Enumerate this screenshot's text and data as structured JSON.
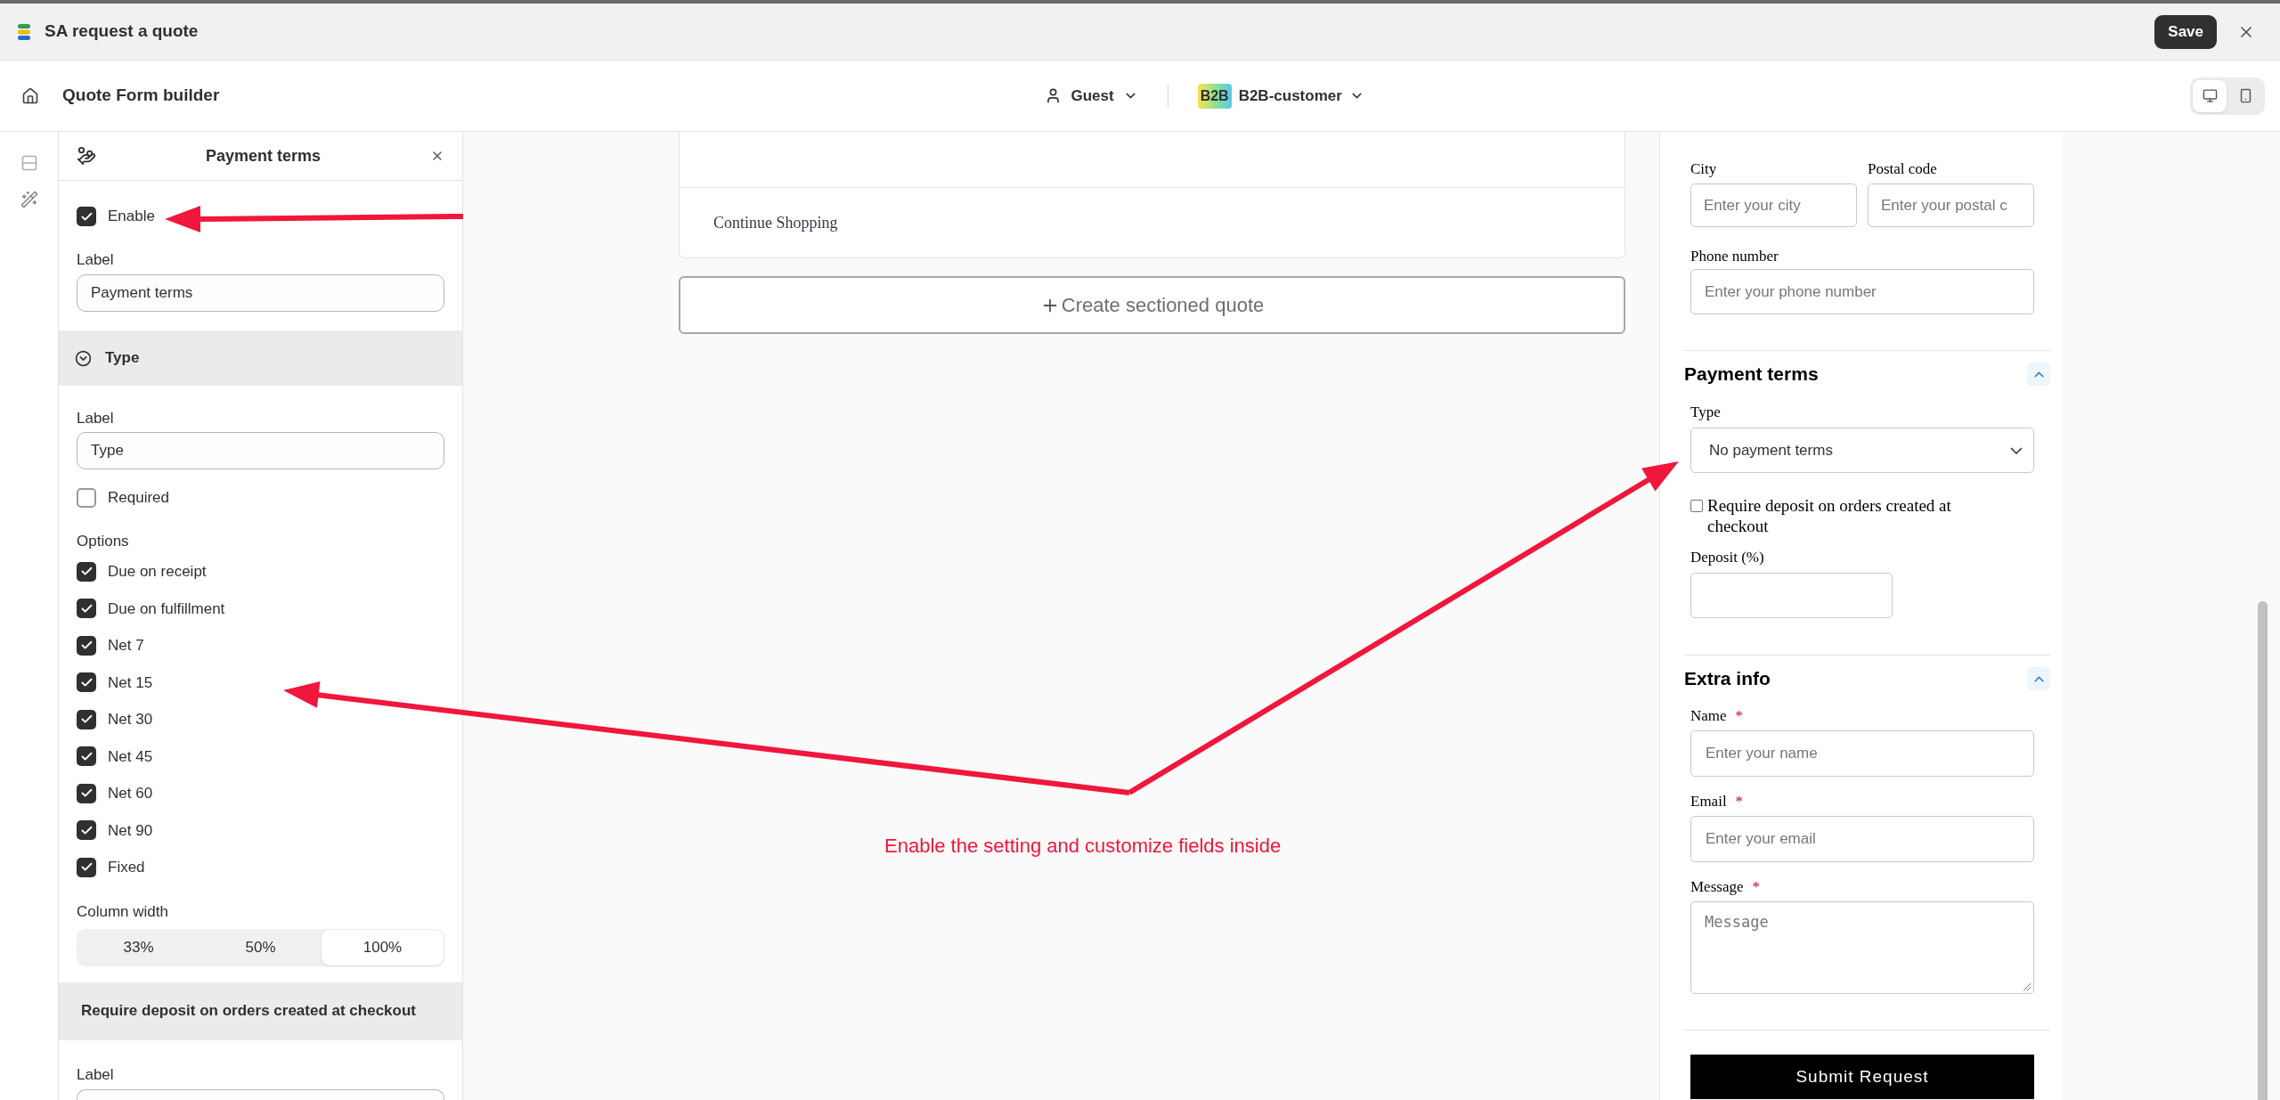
{
  "window": {
    "title": "SA request a quote",
    "save_button": "Save"
  },
  "toolbar": {
    "title": "Quote Form builder",
    "customer": "Guest",
    "customer_group_badge": "B2B",
    "customer_group": "B2B-customer",
    "views": [
      {
        "kind": "desktop",
        "selected": true
      },
      {
        "kind": "mobile",
        "selected": false
      }
    ]
  },
  "settings_panel": {
    "title": "Payment terms",
    "enable": {
      "label": "Enable",
      "checked": true
    },
    "label_field": {
      "label": "Label",
      "value": "Payment terms"
    },
    "type_section": {
      "title": "Type",
      "label_field": {
        "label": "Label",
        "value": "Type"
      },
      "required": {
        "label": "Required",
        "checked": false
      },
      "options_label": "Options",
      "options": [
        {
          "label": "Due on receipt",
          "checked": true
        },
        {
          "label": "Due on fulfillment",
          "checked": true
        },
        {
          "label": "Net 7",
          "checked": true
        },
        {
          "label": "Net 15",
          "checked": true
        },
        {
          "label": "Net 30",
          "checked": true
        },
        {
          "label": "Net 45",
          "checked": true
        },
        {
          "label": "Net 60",
          "checked": true
        },
        {
          "label": "Net 90",
          "checked": true
        },
        {
          "label": "Fixed",
          "checked": true
        }
      ],
      "column_width_label": "Column width",
      "column_widths": [
        {
          "label": "33%",
          "selected": false
        },
        {
          "label": "50%",
          "selected": false
        },
        {
          "label": "100%",
          "selected": true
        }
      ]
    },
    "deposit_section": {
      "title": "Require deposit on orders created at checkout",
      "label_field_label": "Label"
    }
  },
  "preview": {
    "continue_link": "Continue Shopping",
    "create_button": "Create sectioned quote"
  },
  "form": {
    "address_fields": [
      {
        "label": "City",
        "placeholder": "Enter your city"
      },
      {
        "label": "Postal code",
        "placeholder": "Enter your postal c"
      }
    ],
    "phone_field": {
      "label": "Phone number",
      "placeholder": "Enter your phone number"
    },
    "sections": [
      {
        "title": "Payment terms",
        "expanded": true,
        "fields": [
          {
            "kind": "select",
            "label": "Type",
            "value": "No payment terms"
          },
          {
            "kind": "checkbox",
            "label": "Require deposit on orders created at checkout",
            "checked": false
          },
          {
            "kind": "number",
            "label": "Deposit (%)"
          }
        ]
      },
      {
        "title": "Extra info",
        "expanded": true,
        "fields": [
          {
            "kind": "text",
            "label": "Name",
            "required_mark": "*",
            "placeholder": "Enter your name"
          },
          {
            "kind": "text",
            "label": "Email",
            "required_mark": "*",
            "placeholder": "Enter your email"
          },
          {
            "kind": "textarea",
            "label": "Message",
            "required_mark": "*",
            "placeholder": "Message"
          }
        ]
      }
    ],
    "submit_button": "Submit Request"
  },
  "annotation": {
    "text": "Enable the setting and customize fields inside"
  }
}
